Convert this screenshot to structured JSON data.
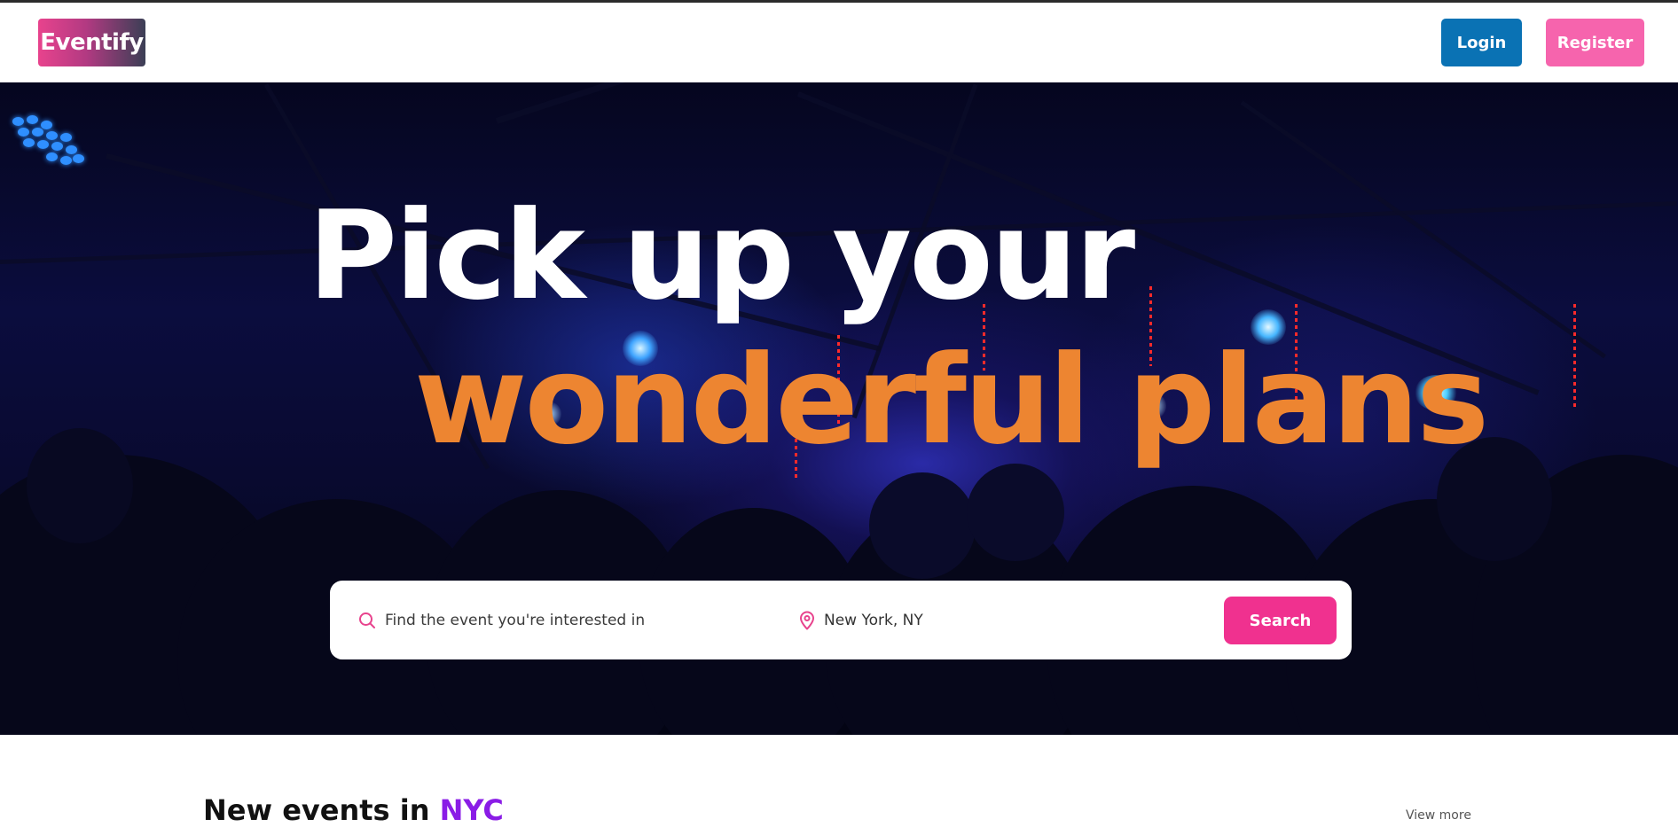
{
  "header": {
    "logo": "Eventify",
    "login_label": "Login",
    "register_label": "Register"
  },
  "hero": {
    "headline_line1": "Pick up your",
    "headline_line2": "wonderful plans",
    "search": {
      "placeholder": "Find the event you're interested in",
      "location_value": "New York, NY",
      "button_label": "Search"
    }
  },
  "section": {
    "title_prefix": "New events in",
    "title_accent": "NYC",
    "view_more_label": "View more"
  },
  "colors": {
    "login": "#0a72b4",
    "register": "#f664ad",
    "search_button": "#f0318f",
    "headline_accent": "#ed8531",
    "section_accent": "#8a1ce6"
  },
  "icons": [
    "search-icon",
    "map-pin-icon"
  ]
}
